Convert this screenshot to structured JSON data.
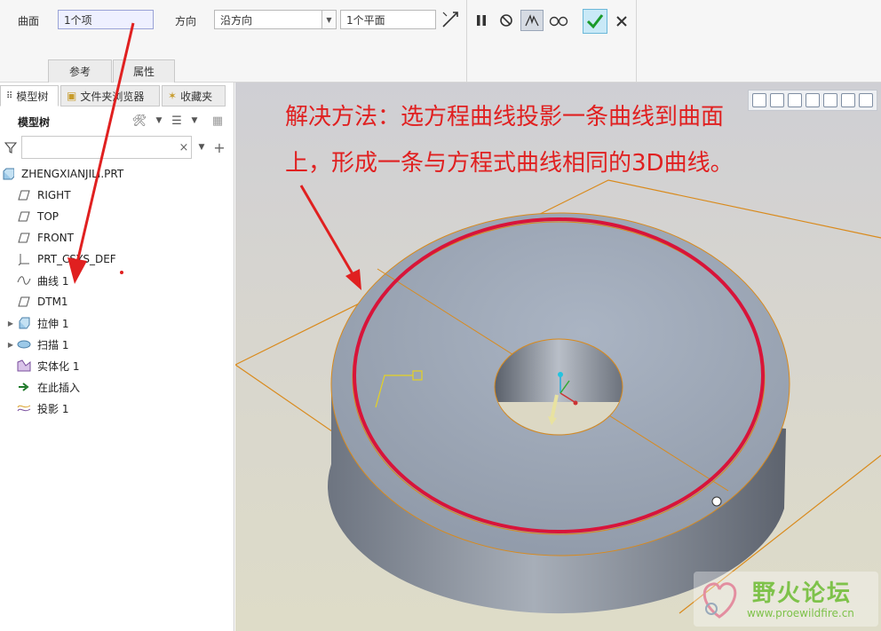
{
  "dashboard": {
    "surface_label": "曲面",
    "surface_value": "1个项",
    "direction_label": "方向",
    "direction_value": "沿方向",
    "plane_value": "1个平面",
    "tabs": [
      "参考",
      "属性"
    ],
    "buttons": [
      "pause-icon",
      "no-preview-icon",
      "preview-icon",
      "glasses-icon",
      "ok-check-icon",
      "cancel-x-icon"
    ]
  },
  "panel": {
    "tabs": [
      "模型树",
      "文件夹浏览器",
      "收藏夹"
    ],
    "tree_header": "模型树",
    "filter_placeholder": "",
    "nodes": [
      {
        "label": "ZHENGXIANJILI.PRT",
        "icon": "part-icon"
      },
      {
        "label": "RIGHT",
        "icon": "datum-plane-icon"
      },
      {
        "label": "TOP",
        "icon": "datum-plane-icon"
      },
      {
        "label": "FRONT",
        "icon": "datum-plane-icon"
      },
      {
        "label": "PRT_CSYS_DEF",
        "icon": "csys-icon"
      },
      {
        "label": "曲线 1",
        "icon": "curve-icon"
      },
      {
        "label": "DTM1",
        "icon": "datum-plane-icon"
      },
      {
        "label": "拉伸 1",
        "icon": "extrude-icon"
      },
      {
        "label": "扫描 1",
        "icon": "sweep-icon"
      },
      {
        "label": "实体化 1",
        "icon": "solidify-icon"
      },
      {
        "label": "在此插入",
        "icon": "insert-here-arrow-icon"
      },
      {
        "label": "投影 1",
        "icon": "projection-icon"
      }
    ]
  },
  "viewport": {
    "annotation_line1": "解决方法：选方程曲线投影一条曲线到曲面",
    "annotation_line2": "上，形成一条与方程式曲线相同的3D曲线。",
    "watermark_title": "野火论坛",
    "watermark_url": "www.proewildfire.cn"
  },
  "colors": {
    "annotation_red": "#e02020",
    "curve_red": "#d8143a",
    "edge_orange": "#d98a1c",
    "ok_green": "#1a9a2a",
    "watermark_green": "#7ec24a"
  }
}
